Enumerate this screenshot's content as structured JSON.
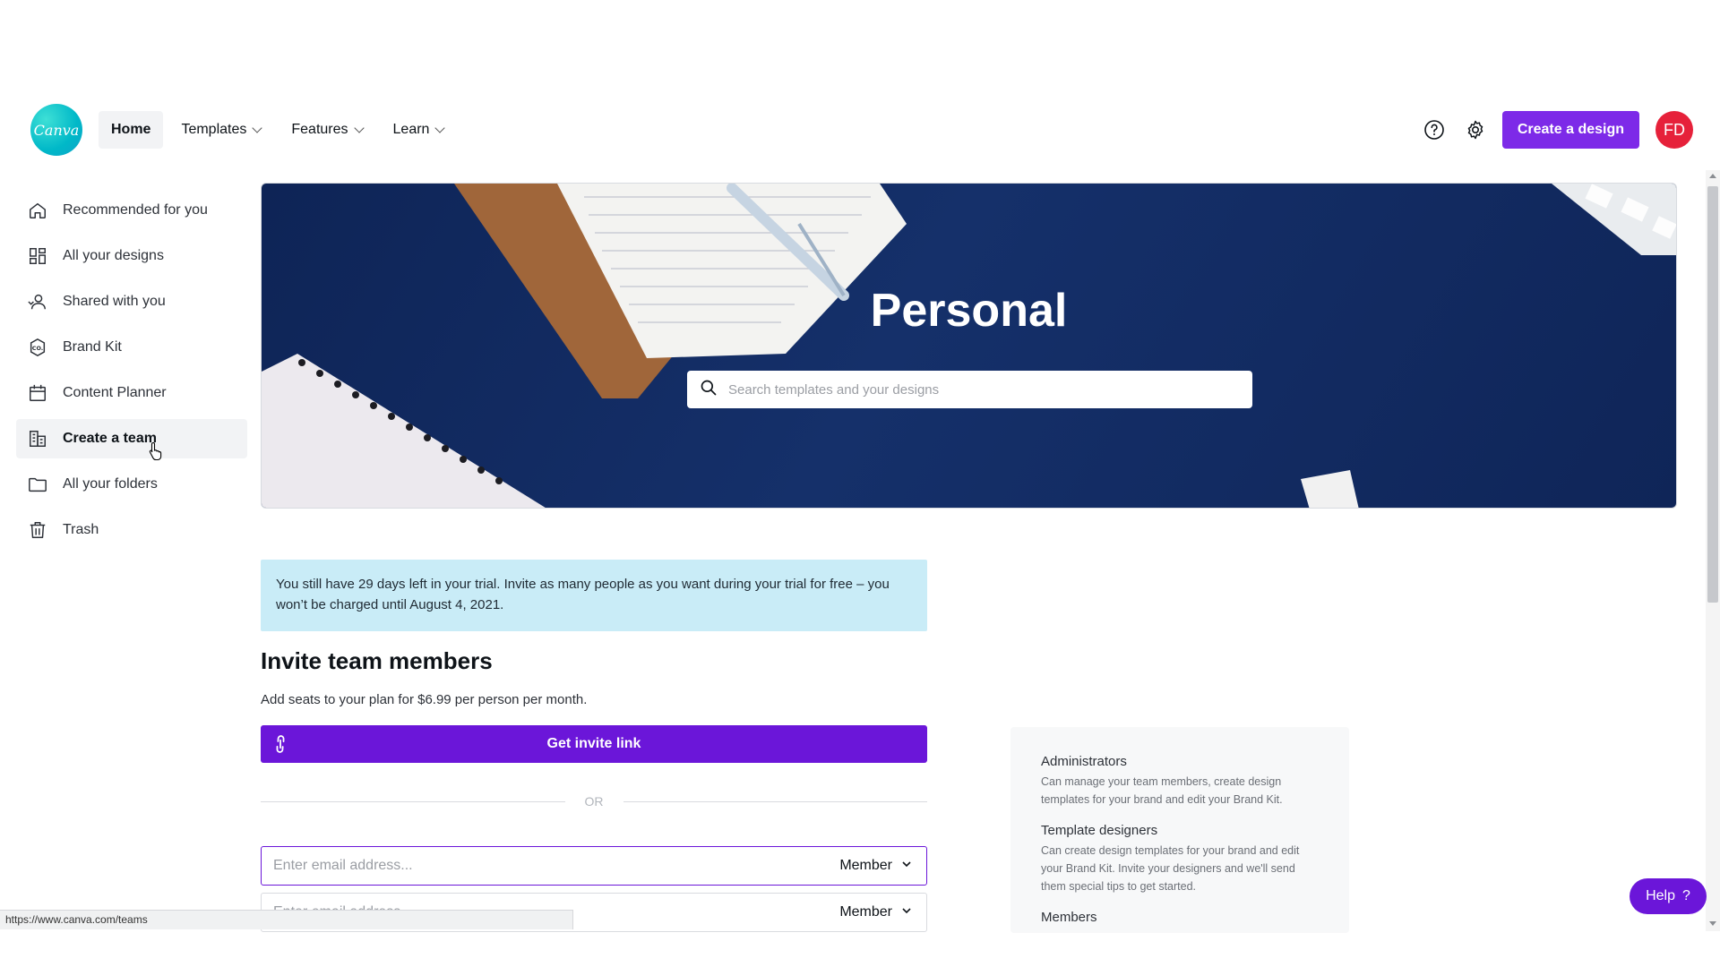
{
  "brand": {
    "logo_text": "Canva",
    "accent": "#7d2ae8",
    "teal": "#00c4cc"
  },
  "nav": {
    "items": [
      {
        "label": "Home",
        "active": true,
        "has_dropdown": false
      },
      {
        "label": "Templates",
        "active": false,
        "has_dropdown": true
      },
      {
        "label": "Features",
        "active": false,
        "has_dropdown": true
      },
      {
        "label": "Learn",
        "active": false,
        "has_dropdown": true
      }
    ],
    "help_icon": "question-circle-icon",
    "settings_icon": "gear-icon",
    "create_label": "Create a design",
    "avatar_initials": "FD"
  },
  "sidebar": {
    "items": [
      {
        "label": "Recommended for you",
        "icon": "home-icon"
      },
      {
        "label": "All your designs",
        "icon": "grid-icon"
      },
      {
        "label": "Shared with you",
        "icon": "shared-users-icon"
      },
      {
        "label": "Brand Kit",
        "icon": "brand-kit-icon"
      },
      {
        "label": "Content Planner",
        "icon": "calendar-icon"
      },
      {
        "label": "Create a team",
        "icon": "team-building-icon",
        "active": true
      },
      {
        "label": "All your folders",
        "icon": "folder-icon"
      },
      {
        "label": "Trash",
        "icon": "trash-icon"
      }
    ]
  },
  "hero": {
    "title": "Personal",
    "search_placeholder": "Search templates and your designs"
  },
  "trial": {
    "message": "You still have 29 days left in your trial. Invite as many people as you want during your trial for free – you won’t be charged until August 4, 2021."
  },
  "invite": {
    "title": "Invite team members",
    "subtitle": "Add seats to your plan for $6.99 per person per month.",
    "link_button": "Get invite link",
    "or_label": "OR",
    "email_rows": [
      {
        "placeholder": "Enter email address...",
        "role": "Member"
      },
      {
        "placeholder": "Enter email address...",
        "role": "Member"
      }
    ]
  },
  "roles": [
    {
      "title": "Administrators",
      "description": "Can manage your team members, create design templates for your brand and edit your Brand Kit."
    },
    {
      "title": "Template designers",
      "description": "Can create design templates for your brand and edit your Brand Kit. Invite your designers and we'll send them special tips to get started."
    },
    {
      "title": "Members",
      "description": ""
    }
  ],
  "help": {
    "label": "Help",
    "glyph": "?"
  },
  "status_bar": {
    "url": "https://www.canva.com/teams"
  }
}
